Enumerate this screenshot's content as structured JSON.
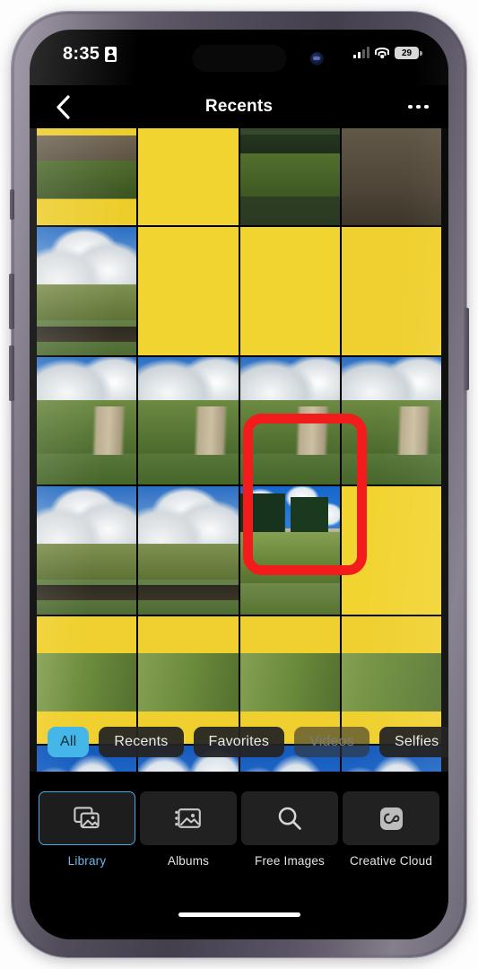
{
  "status_bar": {
    "time": "8:35",
    "recording_icon": "person-badge-icon",
    "signal_icon": "cellular-signal-icon",
    "signal_bars_filled": 2,
    "signal_bars_total": 4,
    "wifi_icon": "wifi-icon",
    "battery_level": "29",
    "dynamic_island": "dynamic-island",
    "camera_lens": "camera-lens"
  },
  "nav_bar": {
    "back_icon": "chevron-left-icon",
    "title": "Recents",
    "more_icon": "ellipsis-icon"
  },
  "photo_grid": {
    "columns": 4,
    "cells": [
      {
        "name": "photo-thumb-hill-slope",
        "style": "p-hill-top"
      },
      {
        "name": "photo-thumb-green-leaves",
        "style": "p-green-top"
      },
      {
        "name": "photo-thumb-meadow-edge",
        "style": "p-ridge-top"
      },
      {
        "name": "photo-thumb-dirt-ridge",
        "style": "p-dirt-top"
      },
      {
        "name": "photo-thumb-hillside-pines",
        "style": "p-sky-wide"
      },
      {
        "name": "photo-thumb-wildflowers-1",
        "style": "p-meadow-flowers"
      },
      {
        "name": "photo-thumb-wildflowers-2",
        "style": "p-meadow-flowers"
      },
      {
        "name": "photo-thumb-wildflowers-3",
        "style": "p-forest-ridge"
      },
      {
        "name": "photo-thumb-valley-clouds",
        "style": "p-trail"
      },
      {
        "name": "photo-thumb-meadow-path-1",
        "style": "p-trail"
      },
      {
        "name": "photo-thumb-meadow-path-2",
        "style": "p-trail"
      },
      {
        "name": "photo-thumb-dirt-road",
        "style": "p-trail"
      },
      {
        "name": "photo-thumb-meadow-sky-1",
        "style": "p-sky-wide"
      },
      {
        "name": "photo-thumb-meadow-sky-2",
        "style": "p-sky-wide"
      },
      {
        "name": "photo-thumb-pine-trees-selected",
        "style": "p-pines-hero"
      },
      {
        "name": "photo-thumb-flower-field",
        "style": "p-meadow-flowers"
      },
      {
        "name": "photo-thumb-forest-meadow-1",
        "style": "p-slope"
      },
      {
        "name": "photo-thumb-forest-meadow-2",
        "style": "p-slope"
      },
      {
        "name": "photo-thumb-forest-meadow-3",
        "style": "p-slope"
      },
      {
        "name": "photo-thumb-forest-meadow-4",
        "style": "p-slope"
      },
      {
        "name": "photo-thumb-clouds-1",
        "style": "p-cloud-crop"
      },
      {
        "name": "photo-thumb-mountain-peak",
        "style": "p-peak-crop"
      },
      {
        "name": "photo-thumb-clouds-2",
        "style": "p-cloud-crop"
      },
      {
        "name": "photo-thumb-clouds-3",
        "style": "p-cloud-crop"
      }
    ],
    "annotation": {
      "name": "red-highlight-box",
      "color": "#f21c1c",
      "targets": "photo-thumb-pine-trees-selected"
    }
  },
  "filter_chips": {
    "items": [
      {
        "label": "All",
        "state": "selected"
      },
      {
        "label": "Recents",
        "state": "normal"
      },
      {
        "label": "Favorites",
        "state": "normal"
      },
      {
        "label": "Videos",
        "state": "disabled"
      },
      {
        "label": "Selfies",
        "state": "normal"
      }
    ],
    "selected_bg": "#45b6e8"
  },
  "tab_bar": {
    "accent": "#4aa9e8",
    "items": [
      {
        "label": "Library",
        "icon": "photo-stack-icon",
        "state": "selected"
      },
      {
        "label": "Albums",
        "icon": "photo-album-icon",
        "state": "normal"
      },
      {
        "label": "Free Images",
        "icon": "search-icon",
        "state": "normal"
      },
      {
        "label": "Creative Cloud",
        "icon": "creative-cloud-icon",
        "state": "normal"
      }
    ]
  },
  "home_indicator": "home-indicator"
}
